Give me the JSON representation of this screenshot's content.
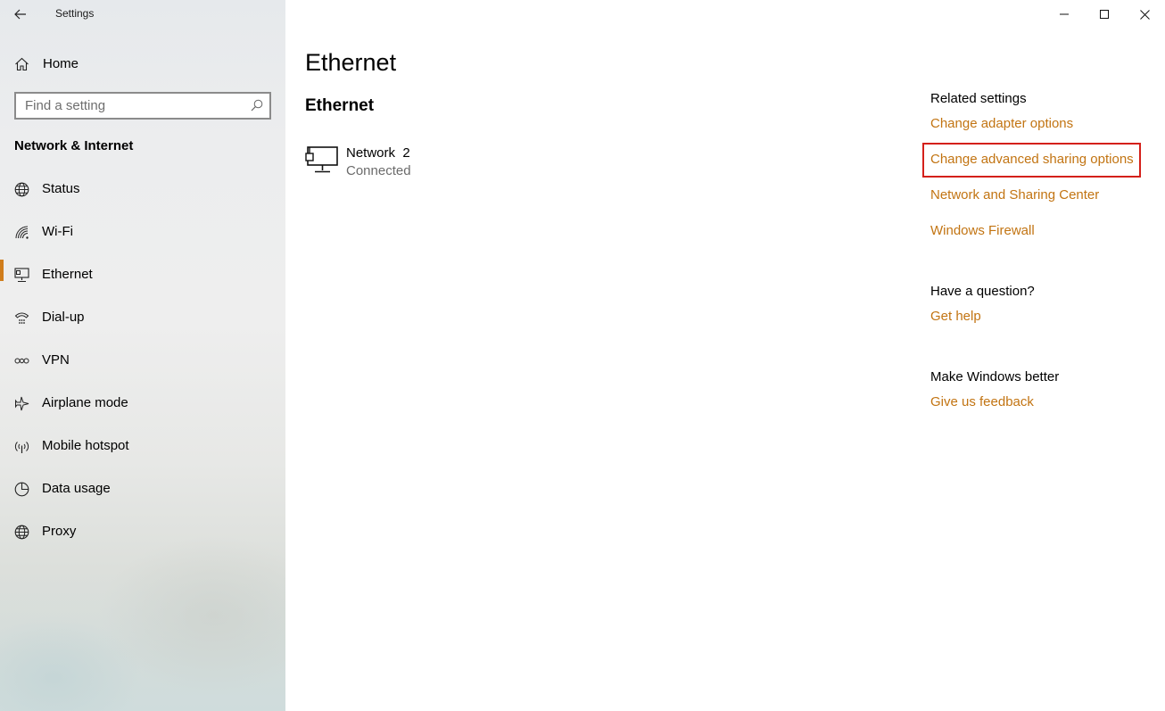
{
  "window": {
    "title": "Settings",
    "controls": [
      "minimize",
      "maximize",
      "close"
    ]
  },
  "sidebar": {
    "home_label": "Home",
    "search_placeholder": "Find a setting",
    "section_title": "Network & Internet",
    "items": [
      {
        "label": "Status",
        "icon": "globe-icon",
        "active": false
      },
      {
        "label": "Wi-Fi",
        "icon": "wifi-icon",
        "active": false
      },
      {
        "label": "Ethernet",
        "icon": "ethernet-icon",
        "active": true
      },
      {
        "label": "Dial-up",
        "icon": "dialup-icon",
        "active": false
      },
      {
        "label": "VPN",
        "icon": "vpn-icon",
        "active": false
      },
      {
        "label": "Airplane mode",
        "icon": "airplane-icon",
        "active": false
      },
      {
        "label": "Mobile hotspot",
        "icon": "hotspot-icon",
        "active": false
      },
      {
        "label": "Data usage",
        "icon": "data-usage-icon",
        "active": false
      },
      {
        "label": "Proxy",
        "icon": "globe-icon",
        "active": false
      }
    ]
  },
  "main": {
    "title": "Ethernet",
    "subtitle": "Ethernet",
    "network": {
      "name": "Network  2",
      "status": "Connected",
      "icon": "wired-network-icon"
    }
  },
  "related": {
    "heading": "Related settings",
    "links": [
      "Change adapter options",
      "Change advanced sharing options",
      "Network and Sharing Center",
      "Windows Firewall"
    ],
    "question_heading": "Have a question?",
    "help_link": "Get help",
    "better_heading": "Make Windows better",
    "feedback_link": "Give us feedback"
  },
  "colors": {
    "accent": "#c27412",
    "active_indicator": "#d07d1c",
    "highlight_box": "#d4201a"
  }
}
